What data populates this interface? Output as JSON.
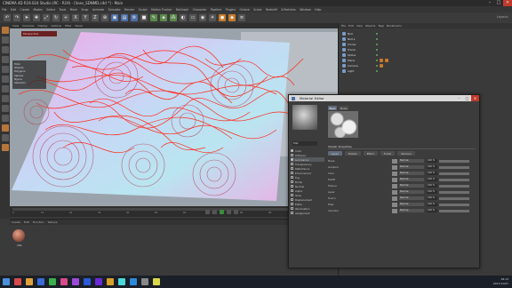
{
  "window": {
    "title": "CINEMA 4D R19.024 Studio (RC - R19) - [lines_SDNMD.c4d *] - Main",
    "min": "–",
    "max": "□",
    "close": "✕"
  },
  "menubar": {
    "items": [
      "File",
      "Edit",
      "Create",
      "Modes",
      "Select",
      "Tools",
      "Mesh",
      "Snap",
      "Animate",
      "Simulate",
      "Render",
      "Sculpt",
      "Motion Tracker",
      "MoGraph",
      "Character",
      "Pipeline",
      "Plugins",
      "Octane",
      "Script",
      "Redshift",
      "X-Particles",
      "Window",
      "Help"
    ]
  },
  "layout_label": "Layout:",
  "viewport": {
    "menu": [
      "View",
      "Cameras",
      "Display",
      "Options",
      "Filter",
      "Panel"
    ],
    "label": "Perspective",
    "hud": [
      "Total",
      "Objects",
      "Polygons",
      "Splines",
      "Ngons",
      "Selection"
    ]
  },
  "timeline": {
    "ticks": [
      "0",
      "10",
      "20",
      "30",
      "40",
      "50",
      "60",
      "70",
      "80",
      "90"
    ]
  },
  "material_panel": {
    "menu": [
      "Create",
      "Edit",
      "Function",
      "Texture"
    ],
    "mat_name": "Mat"
  },
  "object_manager": {
    "menu": [
      "File",
      "Edit",
      "View",
      "Objects",
      "Tags",
      "Bookmarks"
    ],
    "rows": [
      "Null",
      "Null.1",
      "Cloner",
      "Tracer",
      "Spline",
      "Plane",
      "Camera",
      "Light"
    ]
  },
  "material_editor": {
    "title": "Material Editor",
    "preview_label": "Mat",
    "tabs": [
      "Basic",
      "Noise"
    ],
    "channels": [
      {
        "label": "Color",
        "on": true,
        "selected": false
      },
      {
        "label": "Diffusion",
        "on": false,
        "selected": false
      },
      {
        "label": "Luminance",
        "on": true,
        "selected": true
      },
      {
        "label": "Transparency",
        "on": false,
        "selected": false
      },
      {
        "label": "Reflectance",
        "on": false,
        "selected": false
      },
      {
        "label": "Environment",
        "on": false,
        "selected": false
      },
      {
        "label": "Fog",
        "on": false,
        "selected": false
      },
      {
        "label": "Bump",
        "on": false,
        "selected": false
      },
      {
        "label": "Normal",
        "on": false,
        "selected": false
      },
      {
        "label": "Alpha",
        "on": false,
        "selected": false
      },
      {
        "label": "Glow",
        "on": false,
        "selected": false
      },
      {
        "label": "Displacement",
        "on": false,
        "selected": false
      },
      {
        "label": "Editor",
        "on": false,
        "selected": false
      },
      {
        "label": "Illumination",
        "on": false,
        "selected": false
      },
      {
        "label": "Assignment",
        "on": false,
        "selected": false
      }
    ],
    "section": "Shader Properties",
    "section_buttons": [
      "Layer",
      "Shader",
      "Effect",
      "Folder",
      "Remove"
    ],
    "rows": [
      {
        "label": "Noise",
        "mode": "Normal",
        "value": "100 %"
      },
      {
        "label": "Gradient",
        "mode": "Normal",
        "value": "100 %"
      },
      {
        "label": "Color",
        "mode": "Normal",
        "value": "100 %"
      },
      {
        "label": "Falloff",
        "mode": "Normal",
        "value": "100 %"
      },
      {
        "label": "Fresnel",
        "mode": "Normal",
        "value": "100 %"
      },
      {
        "label": "Layer",
        "mode": "Normal",
        "value": "100 %"
      },
      {
        "label": "Fusion",
        "mode": "Normal",
        "value": "100 %"
      },
      {
        "label": "Filter",
        "mode": "Normal",
        "value": "100 %"
      },
      {
        "label": "Colorizer",
        "mode": "Normal",
        "value": "100 %"
      }
    ]
  },
  "taskbar": {
    "clock_time": "18:13",
    "clock_date": "2017/11/07"
  },
  "colors": {
    "accent": "#b8753a",
    "viewport_bg": "#9aa3ab",
    "spline_red": "#ff2a1a",
    "surface_pink": "#e7b4e6",
    "surface_cyan": "#b9e5f0"
  }
}
